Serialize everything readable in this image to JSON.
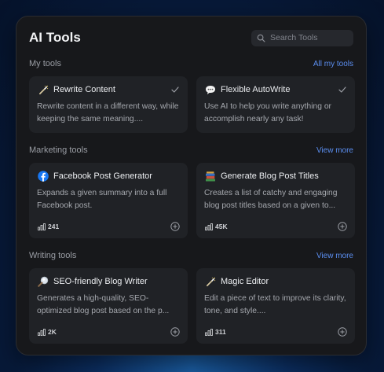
{
  "header": {
    "title": "AI Tools",
    "search_placeholder": "Search Tools"
  },
  "sections": [
    {
      "title": "My tools",
      "link": "All my tools",
      "cards": [
        {
          "icon": "magic-wand-icon",
          "title": "Rewrite Content",
          "description": "Rewrite content in a different way, while keeping the same meaning...."
        },
        {
          "icon": "speech-bubble-icon",
          "title": "Flexible AutoWrite",
          "description": "Use AI to help you write anything or accomplish nearly any task!"
        }
      ]
    },
    {
      "title": "Marketing tools",
      "link": "View more",
      "cards": [
        {
          "icon": "facebook-icon",
          "title": "Facebook Post Generator",
          "description": "Expands a given summary into a full Facebook post.",
          "stat": "241"
        },
        {
          "icon": "books-icon",
          "title": "Generate Blog Post Titles",
          "description": "Creates a list of catchy and engaging blog post titles based on a given to...",
          "stat": "45K"
        }
      ]
    },
    {
      "title": "Writing tools",
      "link": "View more",
      "cards": [
        {
          "icon": "magnifier-icon",
          "title": "SEO-friendly Blog Writer",
          "description": "Generates a high-quality, SEO-optimized blog post based on the p...",
          "stat": "2K"
        },
        {
          "icon": "magic-wand-icon",
          "title": "Magic Editor",
          "description": "Edit a piece of text to improve its clarity, tone, and style....",
          "stat": "311"
        }
      ]
    }
  ],
  "colors": {
    "accent": "#5b8ef0",
    "panel": "#17181b",
    "card": "#202226"
  }
}
